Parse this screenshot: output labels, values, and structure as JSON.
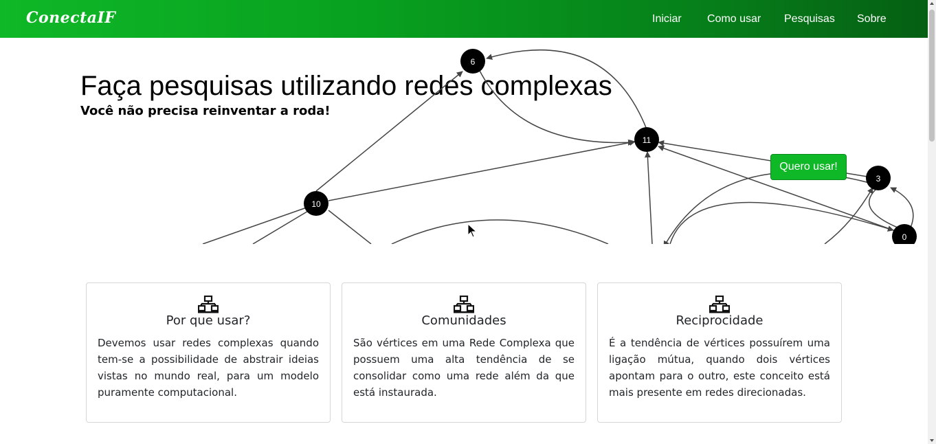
{
  "navbar": {
    "brand": "ConectaIF",
    "links": [
      "Iniciar",
      "Como usar",
      "Pesquisas",
      "Sobre"
    ]
  },
  "hero": {
    "title": "Faça pesquisas utilizando redes complexas",
    "subtitle": "Você não precisa reinventar a roda!",
    "cta_label": "Quero usar!"
  },
  "graph": {
    "node_labels": [
      "6",
      "11",
      "10",
      "3",
      "0"
    ]
  },
  "cards": [
    {
      "icon": "network-icon",
      "title": "Por que usar?",
      "text": "Devemos usar redes complexas quando tem-se a possibilidade de abstrair ideias vistas no mundo real, para um modelo puramente computacional."
    },
    {
      "icon": "network-icon",
      "title": "Comunidades",
      "text": "São vértices em uma Rede Complexa que possuem uma alta tendência de se consolidar como uma rede além da que está instaurada."
    },
    {
      "icon": "network-icon",
      "title": "Reciprocidade",
      "text": "É a tendência de vértices possuírem uma ligação mútua, quando dois vértices apontam para o outro, este conceito está mais presente em redes direcionadas."
    }
  ],
  "colors": {
    "navbar_start": "#0fb827",
    "navbar_end": "#055f13",
    "button": "#0fb827",
    "node": "#000000"
  }
}
